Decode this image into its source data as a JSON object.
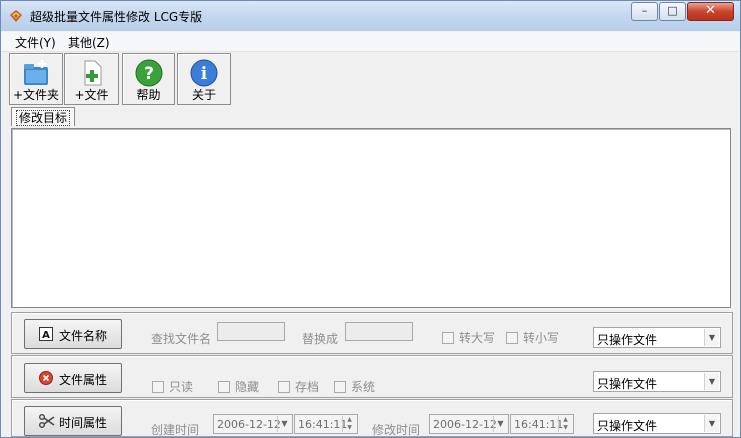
{
  "window": {
    "title": "超级批量文件属性修改 LCG专版",
    "minimize": "–",
    "maximize": "□",
    "close": "✕"
  },
  "menu": [
    "文件(Y)",
    "其他(Z)"
  ],
  "toolbar": {
    "add_folder": "+文件夹",
    "add_file": "+文件",
    "help": "帮助",
    "about": "关于"
  },
  "tab": {
    "label": "修改目标"
  },
  "rename_panel": {
    "button": "文件名称",
    "find_label": "查找文件名",
    "find_value": "",
    "replace_label": "替换成",
    "replace_value": "",
    "uppercase": "转大写",
    "lowercase": "转小写",
    "scope": "只操作文件"
  },
  "attr_panel": {
    "button": "文件属性",
    "readonly": "只读",
    "hidden": "隐藏",
    "archive": "存档",
    "system": "系统",
    "scope": "只操作文件"
  },
  "time_panel": {
    "button": "时间属性",
    "created_label": "创建时间",
    "created_date": "2006-12-12",
    "created_time": "16:41:11",
    "modified_label": "修改时间",
    "modified_date": "2006-12-12",
    "modified_time": "16:41:11",
    "scope": "只操作文件"
  },
  "colors": {
    "title_bg": "#c2d6ee",
    "close_red": "#c9442c",
    "face": "#f0f0f0"
  }
}
